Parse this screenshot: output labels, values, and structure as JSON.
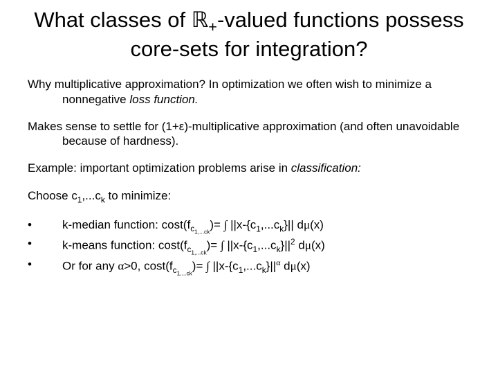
{
  "title": {
    "pre": "What classes of ",
    "r": "ℝ",
    "sub": "+",
    "post": "-valued functions possess core-sets for integration?"
  },
  "p1": {
    "lead": "Why multiplicative approximation? In optimization we often wish to minimize a nonnegative ",
    "it": "loss function.",
    "tail": ""
  },
  "p2": "Makes sense to settle for (1+ε)-multiplicative approximation (and often unavoidable because of hardness).",
  "p3": {
    "lead": "Example: important optimization problems arise in ",
    "it": "classification:",
    "tail": ""
  },
  "p4": {
    "pre": "Choose c",
    "s1": "1",
    "mid": ",...c",
    "s2": "k",
    "post": " to minimize:"
  },
  "bullets": [
    {
      "pre": "k-median function: cost(f",
      "sub1": "c",
      "subsub": "1,...ck",
      "mid1": ")= ",
      "int": "∫",
      "mid2": " ||x-{c",
      "sublist_a": "1",
      "mid3": ",...c",
      "sublist_b": "k",
      "mid4": "}|| d",
      "mu": "μ",
      "tail": "(x)"
    },
    {
      "pre": "k-means function: cost(f",
      "sub1": "c",
      "subsub": "1,...ck",
      "mid1": ")= ",
      "int": "∫",
      "mid2": " ||x-{c",
      "sublist_a": "1",
      "mid3": ",...c",
      "sublist_b": "k",
      "mid4": "}||",
      "sup": "2",
      "mid5": " d",
      "mu": "μ",
      "tail": "(x)"
    },
    {
      "pre": "Or for any ",
      "alpha": "α",
      "mid0": ">0, cost(f",
      "sub1": "c",
      "subsub": "1,...ck",
      "mid1": ")= ",
      "int": "∫",
      "mid2": " ||x-{c",
      "sublist_a": "1",
      "mid3": ",...c",
      "sublist_b": "k",
      "mid4": "}||",
      "sup": "α",
      "mid5": " d",
      "mu": "μ",
      "tail": "(x)"
    }
  ],
  "dot": "•"
}
